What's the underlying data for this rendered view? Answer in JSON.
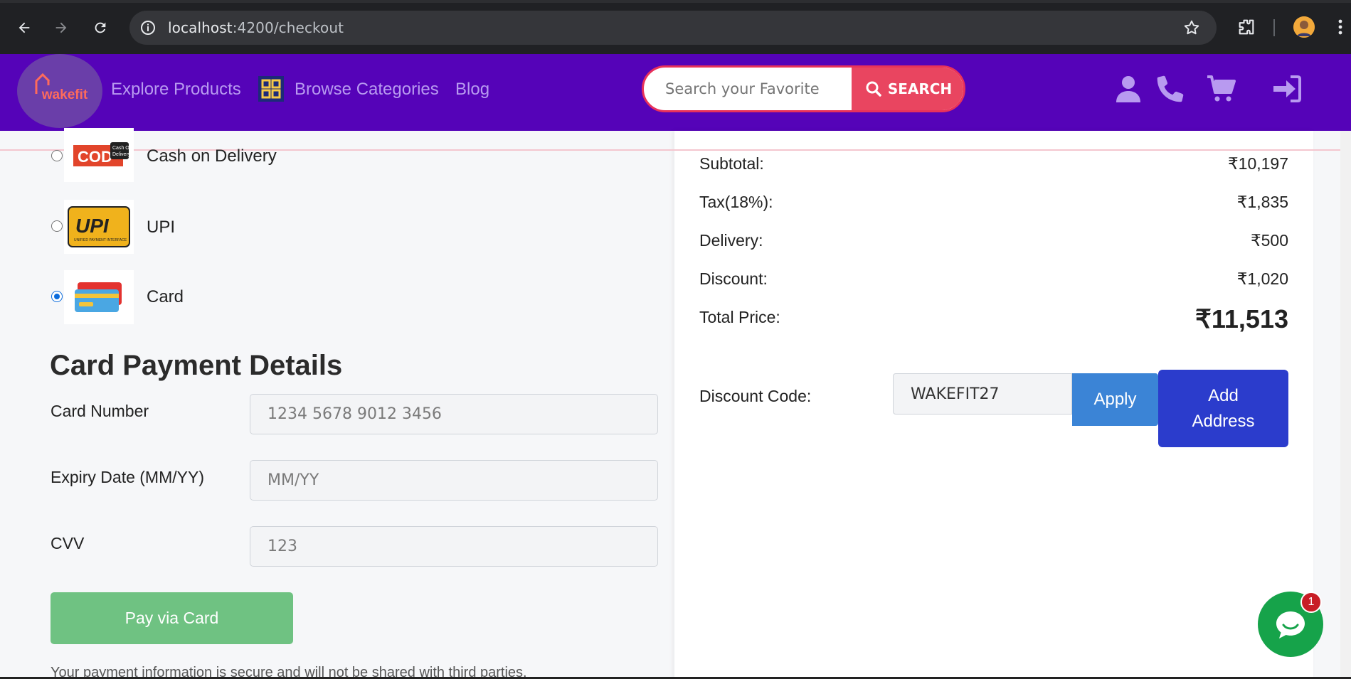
{
  "browser": {
    "url_host": "localhost",
    "url_path": ":4200/checkout"
  },
  "header": {
    "logo_text": "wakefit",
    "nav": [
      "Explore Products",
      "Browse Categories",
      "Blog"
    ],
    "search_placeholder": "Search your Favorite",
    "search_button": "SEARCH"
  },
  "payment": {
    "methods": [
      {
        "label": "Cash on Delivery",
        "icon": "cod-icon",
        "selected": false
      },
      {
        "label": "UPI",
        "icon": "upi-icon",
        "selected": false
      },
      {
        "label": "Card",
        "icon": "card-icon",
        "selected": true
      }
    ],
    "title": "Card Payment Details",
    "fields": {
      "card_number_label": "Card Number",
      "card_number_placeholder": "1234 5678 9012 3456",
      "expiry_label": "Expiry Date (MM/YY)",
      "expiry_placeholder": "MM/YY",
      "cvv_label": "CVV",
      "cvv_placeholder": "123"
    },
    "pay_button": "Pay via Card",
    "secure_note": "Your payment information is secure and will not be shared with third parties."
  },
  "summary": {
    "subtotal_label": "Subtotal:",
    "subtotal": "₹10,197",
    "tax_label": "Tax(18%):",
    "tax": "₹1,835",
    "delivery_label": "Delivery:",
    "delivery": "₹500",
    "discount_label": "Discount:",
    "discount": "₹1,020",
    "total_label": "Total Price:",
    "total": "₹11,513",
    "discount_code_label": "Discount Code:",
    "discount_code_value": "WAKEFIT27",
    "apply_button": "Apply",
    "add_address_button": "Add Address"
  },
  "chat": {
    "badge_count": "1"
  },
  "colors": {
    "header_bg": "#5503b8",
    "search_accent": "#e94560",
    "pay_button": "#6fc282",
    "apply_button": "#3b84d6",
    "address_button": "#2b3ccc",
    "chat_bubble": "#16a34a"
  }
}
